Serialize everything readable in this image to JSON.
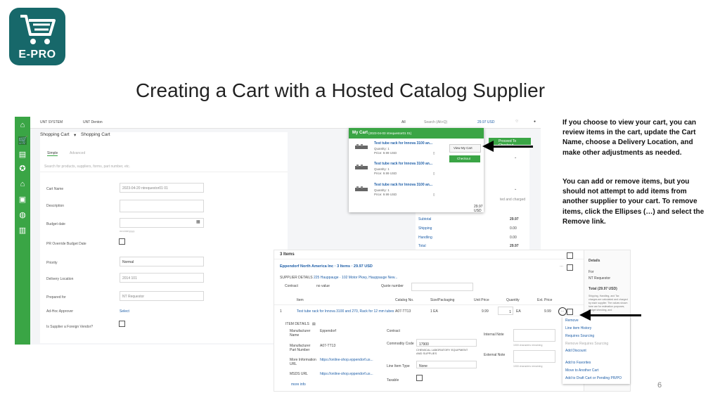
{
  "slide": {
    "title": "Creating a Cart with a Hosted Catalog Supplier",
    "page_number": "6",
    "logo_text": "E-PRO",
    "notes": [
      "If you choose to view your cart, you can review items in the cart, update the Cart Name, choose a Delivery Location, and make other adjustments as needed.",
      "You can add or remove items, but you should not attempt to add items from another supplier to your cart. To remove items, click the Ellipses (…) and select the Remove link."
    ]
  },
  "screenshot1": {
    "topbar": {
      "org": "UNT SYSTEM",
      "org2": "UNT Denton",
      "search_scope": "All",
      "search_placeholder": "Search (Alt+Q)",
      "cart_total": "29.97 USD"
    },
    "breadcrumb": [
      "Shopping Cart",
      "Shopping Cart"
    ],
    "tabs": [
      "Simple",
      "Advanced"
    ],
    "search_hint": "Search for products, suppliers, forms, part number, etc.",
    "fields": [
      {
        "label": "Cart Name",
        "value": "2023-04-20 ntrequestor01 01"
      },
      {
        "label": "Description",
        "value": ""
      },
      {
        "label": "Budget date",
        "value": ""
      },
      {
        "label": "PR Override Budget Date",
        "value": ""
      },
      {
        "label": "Priority",
        "value": "Normal"
      },
      {
        "label": "Delivery Location",
        "value": "2014 101"
      },
      {
        "label": "Prepared for",
        "value": "NT Requestor"
      },
      {
        "label": "Ad-Hoc Approver",
        "value": "Select"
      },
      {
        "label": "Is Supplier a Foreign Vendor?",
        "value": ""
      }
    ],
    "date_hint": "mm/dd/yyyy",
    "summary": {
      "total_small": "29.97 USD",
      "subtotal_label": "Subtotal",
      "subtotal": "29.97",
      "shipping_label": "Shipping",
      "shipping": "0.00",
      "handling_label": "Handling",
      "handling": "0.00",
      "total_label": "Total",
      "total": "29.97",
      "side_note": "ted and charged"
    },
    "proceed_button": "Proceed To Checkout",
    "popup": {
      "title": "My Cart",
      "subtitle": "(2023-04-03 ntrequestor01 01)",
      "view_button": "View My Cart",
      "checkout_button": "Checkout",
      "items": [
        {
          "name": "Test tube rack for Innova 3100 an...",
          "qty": "Quantity: 1",
          "price": "Price: 9.99 USD"
        },
        {
          "name": "Test tube rack for Innova 3100 an...",
          "qty": "Quantity: 1",
          "price": "Price: 9.99 USD"
        },
        {
          "name": "Test tube rack for Innova 3100 an...",
          "qty": "Quantity: 1",
          "price": "Price: 9.99 USD"
        }
      ]
    }
  },
  "screenshot2": {
    "items_header": "3 Items",
    "supplier_line": "Eppendorf North America Inc · 3 Items · 29.97 USD",
    "supplier_details_label": "SUPPLIER DETAILS",
    "supplier_address": "225 Hauppauge · 102 Motor Pkwy, Hauppauge New...",
    "contract_label": "Contract",
    "contract_value": "no value",
    "quote_label": "Quote number",
    "columns": [
      "Item",
      "Catalog No.",
      "Size/Packaging",
      "Unit Price",
      "Quantity",
      "Ext. Price"
    ],
    "row": {
      "item": "Test tube rack for Innova 3100 and 270, Rack for 12 mm tubes",
      "catalog": "A07-TT13",
      "size": "1 EA",
      "unit_price": "9.99",
      "quantity": "1",
      "uom": "EA",
      "ext_price": "9.99"
    },
    "item_details_label": "ITEM DETAILS",
    "details": [
      {
        "label": "Manufacturer Name",
        "value": "Eppendorf"
      },
      {
        "label": "Manufacturer Part Number",
        "value": "A07-TT13"
      },
      {
        "label": "More Information URL",
        "value": "https://online-shop.eppendorf.us..."
      },
      {
        "label": "MSDS URL",
        "value": "https://online-shop.eppendorf.us..."
      }
    ],
    "more_info": "more info",
    "mid_fields": [
      {
        "label": "Contract",
        "value": ""
      },
      {
        "label": "Commodity Code",
        "value": "17900"
      },
      {
        "label": "Line Item Type",
        "value": "None"
      },
      {
        "label": "Taxable",
        "value": ""
      }
    ],
    "commodity_desc": "CHEMICAL LABORATORY EQUIPMENT AND SUPPLIES",
    "internal_note": "Internal Note",
    "external_note": "External Note",
    "chars_remaining": "1000 characters remaining",
    "details_panel": {
      "title": "Details",
      "for_label": "For",
      "for_value": "NT Requestor",
      "total_label": "Total (29.97 USD)",
      "note": "Shipping, Handling, and Tax charges are calculated and charged by each supplier. The values shown here are for estimation purposes, budget checking, and"
    },
    "menu": [
      "Remove",
      "Line item History",
      "Requires Sourcing",
      "Remove Requires Sourcing",
      "Add Discount",
      "Add to Favorites",
      "Move to Another Cart",
      "Add to Draft Cart or Pending PR/PO"
    ]
  },
  "colors": {
    "brand": "#17686a",
    "green": "#3aa545",
    "link": "#1f5fa8"
  }
}
